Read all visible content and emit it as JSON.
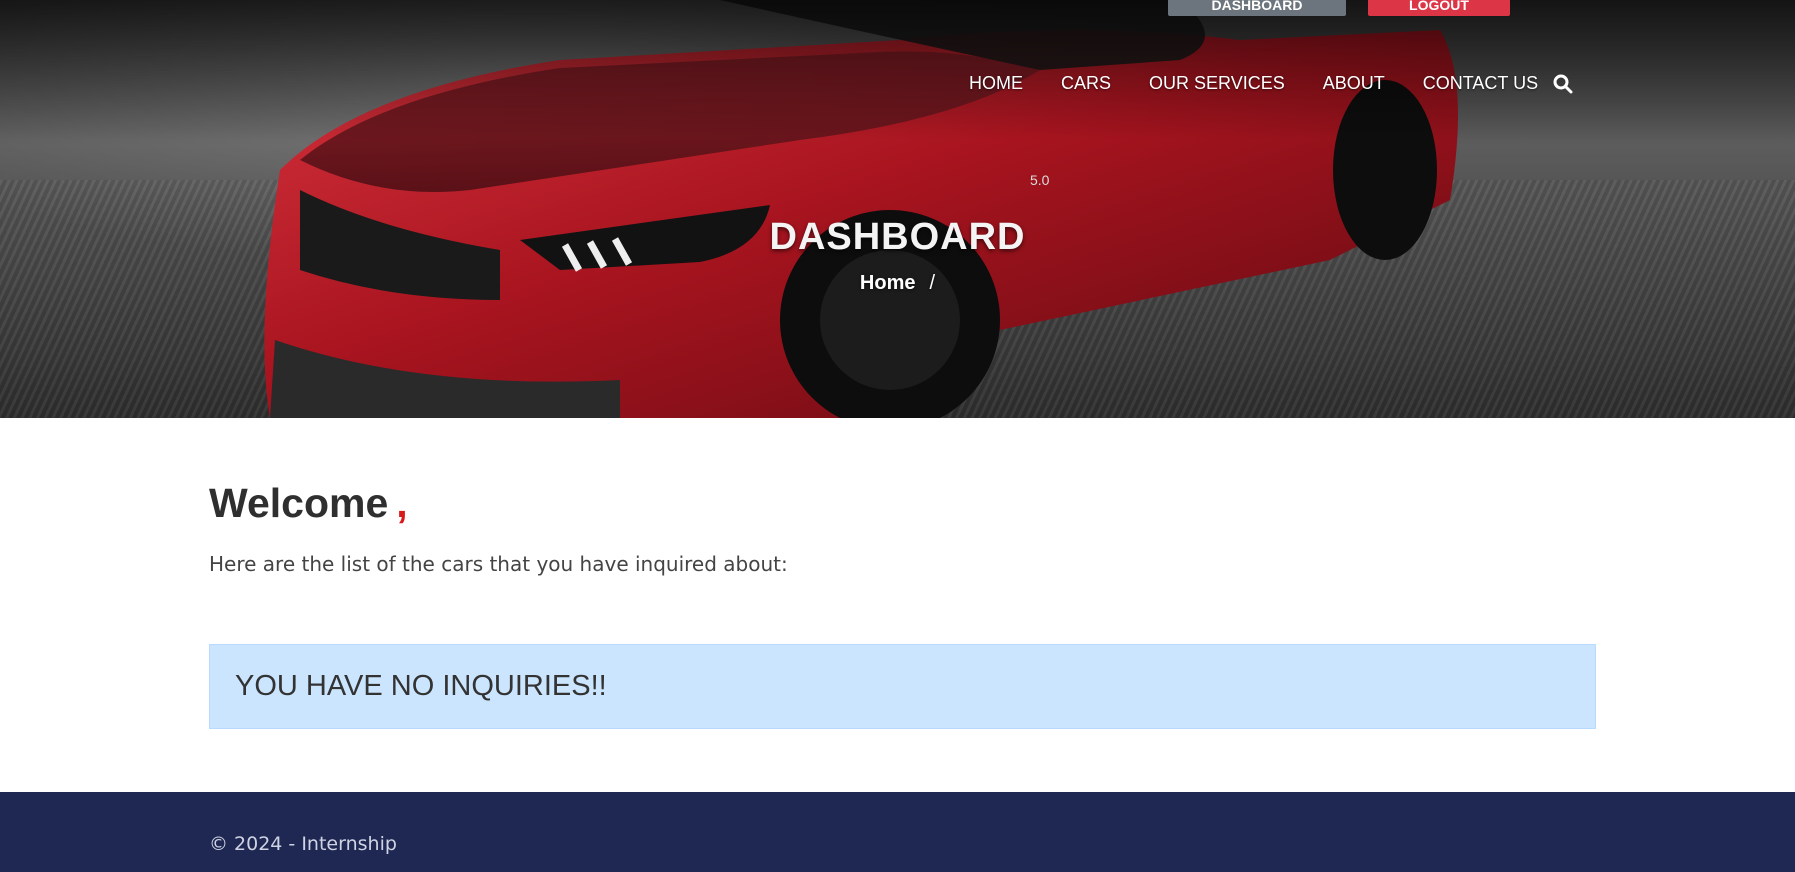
{
  "top_buttons": {
    "dashboard": "DASHBOARD",
    "logout": "LOGOUT"
  },
  "nav": {
    "items": [
      "HOME",
      "CARS",
      "OUR SERVICES",
      "ABOUT",
      "CONTACT US"
    ],
    "search_icon": "search-icon"
  },
  "hero": {
    "title": "DASHBOARD",
    "breadcrumb_home": "Home",
    "breadcrumb_sep": "/"
  },
  "main": {
    "welcome": "Welcome",
    "welcome_suffix": ",",
    "intro": "Here are the list of the cars that you have inquired about:",
    "alert": "YOU HAVE NO INQUIRIES!!"
  },
  "footer": {
    "copyright": "© 2024 - Internship"
  },
  "colors": {
    "accent": "#dc3545",
    "footer_bg": "#1f2853",
    "alert_bg": "#cce5ff",
    "secondary": "#6c757d"
  }
}
